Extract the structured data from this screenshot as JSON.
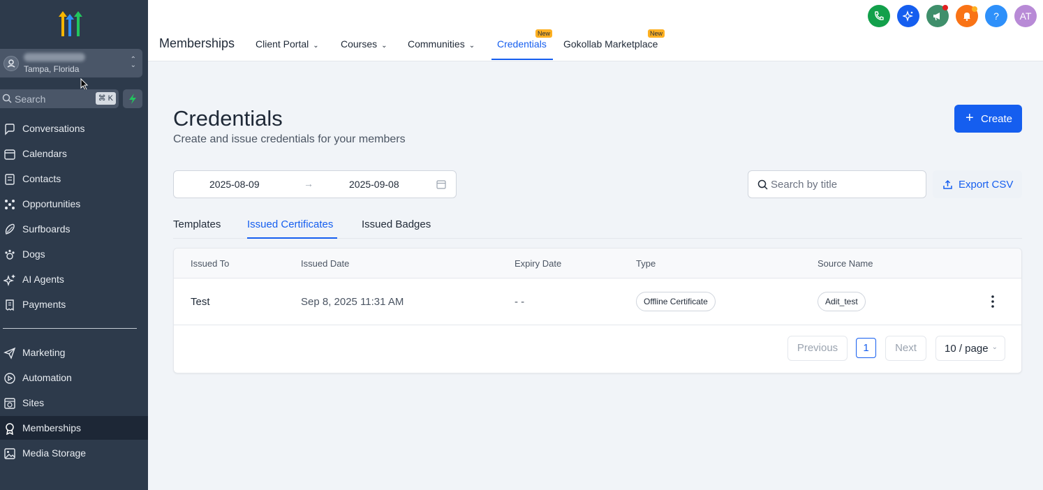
{
  "sidebar": {
    "location": {
      "city": "Tampa, Florida"
    },
    "search": {
      "placeholder": "Search",
      "shortcut": "⌘ K"
    },
    "nav": [
      {
        "label": "Conversations",
        "icon": "chat-bubble-icon"
      },
      {
        "label": "Calendars",
        "icon": "calendar-icon"
      },
      {
        "label": "Contacts",
        "icon": "contacts-book-icon"
      },
      {
        "label": "Opportunities",
        "icon": "opportunities-icon"
      },
      {
        "label": "Surfboards",
        "icon": "surfboard-icon"
      },
      {
        "label": "Dogs",
        "icon": "paw-icon"
      },
      {
        "label": "AI Agents",
        "icon": "sparkle-icon"
      },
      {
        "label": "Payments",
        "icon": "receipt-icon"
      }
    ],
    "nav2": [
      {
        "label": "Marketing",
        "icon": "send-icon"
      },
      {
        "label": "Automation",
        "icon": "automation-icon"
      },
      {
        "label": "Sites",
        "icon": "globe-window-icon"
      },
      {
        "label": "Memberships",
        "icon": "award-icon",
        "active": true
      },
      {
        "label": "Media Storage",
        "icon": "image-icon"
      }
    ]
  },
  "topbar": {
    "brand": "Memberships",
    "tabs": [
      {
        "label": "Client Portal",
        "dropdown": true
      },
      {
        "label": "Courses",
        "dropdown": true
      },
      {
        "label": "Communities",
        "dropdown": true
      },
      {
        "label": "Credentials",
        "active": true,
        "badge": "New"
      },
      {
        "label": "Gokollab Marketplace",
        "badge": "New"
      }
    ],
    "actions": {
      "avatar_initials": "AT",
      "help": "?"
    },
    "colors": {
      "phone": "#12a04b",
      "ai": "#155eef",
      "announce": "#3f8f6b",
      "bell": "#f97316",
      "help": "#2e90fa",
      "avatar": "#b88ad6"
    }
  },
  "page": {
    "title": "Credentials",
    "subtitle": "Create and issue credentials for your members",
    "create_label": "Create",
    "date_from": "2025-08-09",
    "date_to": "2025-09-08",
    "search_placeholder": "Search by title",
    "export_label": "Export CSV",
    "tabs": [
      "Templates",
      "Issued Certificates",
      "Issued Badges"
    ],
    "active_tab": "Issued Certificates"
  },
  "table": {
    "columns": [
      "Issued To",
      "Issued Date",
      "Expiry Date",
      "Type",
      "Source Name"
    ],
    "rows": [
      {
        "issued_to": "Test",
        "issued_date": "Sep 8, 2025 11:31 AM",
        "expiry_date": "- -",
        "type": "Offline Certificate",
        "source_name": "Adit_test"
      }
    ]
  },
  "pagination": {
    "previous": "Previous",
    "current": "1",
    "next": "Next",
    "page_size": "10 / page"
  }
}
